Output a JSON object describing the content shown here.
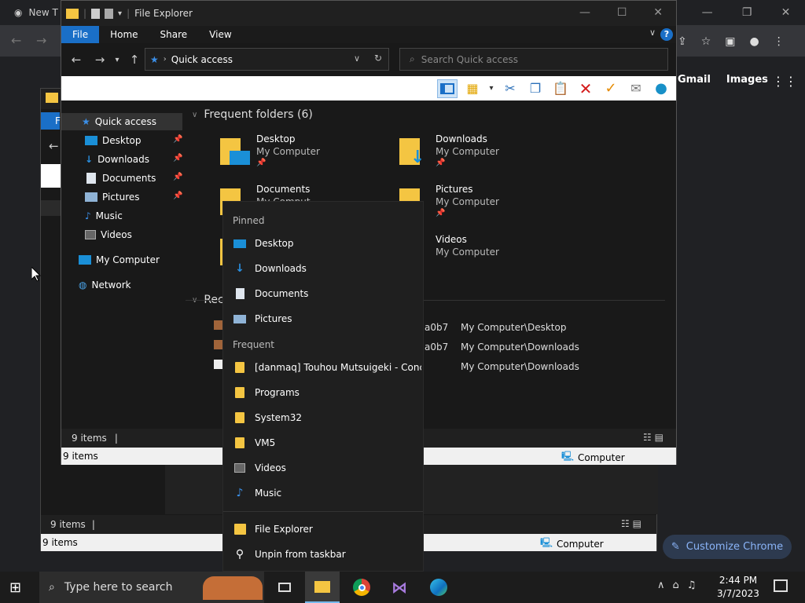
{
  "chrome": {
    "tab_title": "New T",
    "links": [
      "Gmail",
      "Images"
    ],
    "customize_label": "Customize Chrome"
  },
  "explorer": {
    "title": "File Explorer",
    "menu": [
      "File",
      "Home",
      "Share",
      "View"
    ],
    "help": "?",
    "address": "Quick access",
    "search_placeholder": "Search Quick access",
    "sidebar": [
      {
        "label": "Quick access",
        "icon": "star-icon",
        "pinned": false
      },
      {
        "label": "Desktop",
        "icon": "desktop-icon",
        "pinned": true
      },
      {
        "label": "Downloads",
        "icon": "download-icon",
        "pinned": true
      },
      {
        "label": "Documents",
        "icon": "document-icon",
        "pinned": true
      },
      {
        "label": "Pictures",
        "icon": "pictures-icon",
        "pinned": true
      },
      {
        "label": "Music",
        "icon": "music-icon",
        "pinned": false
      },
      {
        "label": "Videos",
        "icon": "videos-icon",
        "pinned": false
      },
      {
        "label": "My Computer",
        "icon": "computer-icon",
        "pinned": false
      },
      {
        "label": "Network",
        "icon": "network-icon",
        "pinned": false
      }
    ],
    "frequent_header": "Frequent folders (6)",
    "frequent": [
      {
        "name": "Desktop",
        "location": "My Computer",
        "pinned": true
      },
      {
        "name": "Downloads",
        "location": "My Computer",
        "pinned": true
      },
      {
        "name": "Documents",
        "location": "My Comput",
        "pinned": false
      },
      {
        "name": "Pictures",
        "location": "My Computer",
        "pinned": true
      },
      {
        "name": "Videos",
        "location": "My Computer",
        "pinned": false
      }
    ],
    "recent_header": "Rece",
    "recent": [
      {
        "name_tail": "a0b7",
        "path": "My Computer\\Desktop"
      },
      {
        "name_tail": "a0b7",
        "path": "My Computer\\Downloads"
      },
      {
        "name_tail": "",
        "path": "My Computer\\Downloads"
      }
    ],
    "status_items": "9 items",
    "status_items2": "9 items",
    "status_computer": "Computer"
  },
  "explorer_back": {
    "menu_first": "F",
    "status_items": "9 items",
    "status_items2": "9 items",
    "status_computer": "Computer"
  },
  "jumplist": {
    "pinned_header": "Pinned",
    "pinned": [
      {
        "label": "Desktop",
        "icon": "desktop-icon"
      },
      {
        "label": "Downloads",
        "icon": "download-icon"
      },
      {
        "label": "Documents",
        "icon": "document-icon"
      },
      {
        "label": "Pictures",
        "icon": "pictures-icon"
      }
    ],
    "frequent_header": "Frequent",
    "frequent": [
      {
        "label": "[danmaq] Touhou Mutsuigeki - Conce...",
        "icon": "folder-icon"
      },
      {
        "label": "Programs",
        "icon": "folder-icon"
      },
      {
        "label": "System32",
        "icon": "folder-icon"
      },
      {
        "label": "VM5",
        "icon": "folder-icon"
      },
      {
        "label": "Videos",
        "icon": "videos-icon"
      },
      {
        "label": "Music",
        "icon": "music-icon"
      }
    ],
    "app_label": "File Explorer",
    "unpin_label": "Unpin from taskbar"
  },
  "taskbar": {
    "search_placeholder": "Type here to search",
    "time": "2:44 PM",
    "date": "3/7/2023"
  }
}
